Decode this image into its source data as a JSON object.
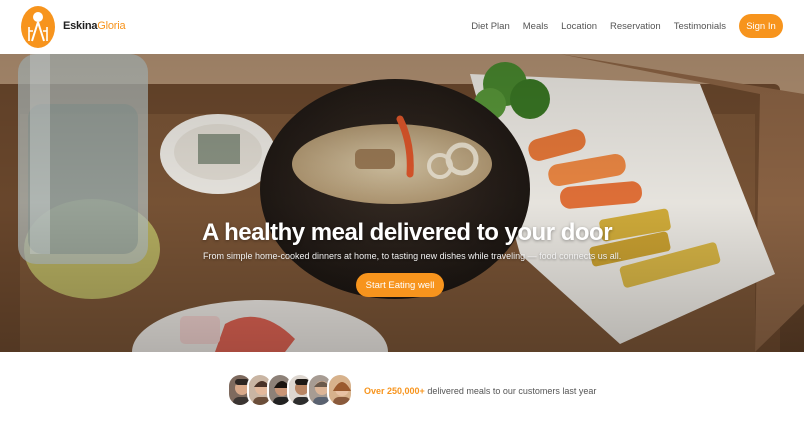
{
  "brand": {
    "name_part1": "Eskina",
    "name_part2": "Gloria",
    "accent": "#f7941d"
  },
  "nav": {
    "links": [
      "Diet Plan",
      "Meals",
      "Location",
      "Reservation",
      "Testimonials"
    ],
    "signin_label": "Sign In"
  },
  "hero": {
    "title": "A healthy meal delivered to your door",
    "subtitle": "From simple home-cooked dinners at home, to tasting new dishes while traveling — food connects us all.",
    "cta_label": "Start Eating well"
  },
  "stats": {
    "highlight": "Over 250,000+",
    "rest": " delivered meals to our customers last year",
    "avatars": [
      "customer-1",
      "customer-2",
      "customer-3",
      "customer-4",
      "customer-5",
      "customer-6"
    ]
  }
}
